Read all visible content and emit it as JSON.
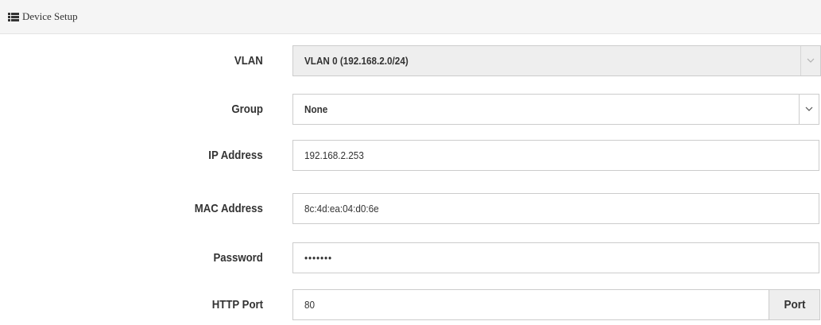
{
  "panel": {
    "title": "Device Setup",
    "icon": "list-icon"
  },
  "form": {
    "vlan": {
      "label": "VLAN",
      "value": "VLAN 0 (192.168.2.0/24)",
      "disabled": true
    },
    "group": {
      "label": "Group",
      "value": "None"
    },
    "ip_address": {
      "label": "IP Address",
      "value": "192.168.2.253"
    },
    "mac_address": {
      "label": "MAC Address",
      "value": "8c:4d:ea:04:d0:6e"
    },
    "password": {
      "label": "Password",
      "value": "•••••••"
    },
    "http_port": {
      "label": "HTTP Port",
      "value": "80",
      "addon": "Port"
    }
  },
  "colors": {
    "header_bg": "#f5f5f5",
    "border": "#cccccc",
    "disabled_bg": "#eeeeee",
    "text": "#333333"
  }
}
